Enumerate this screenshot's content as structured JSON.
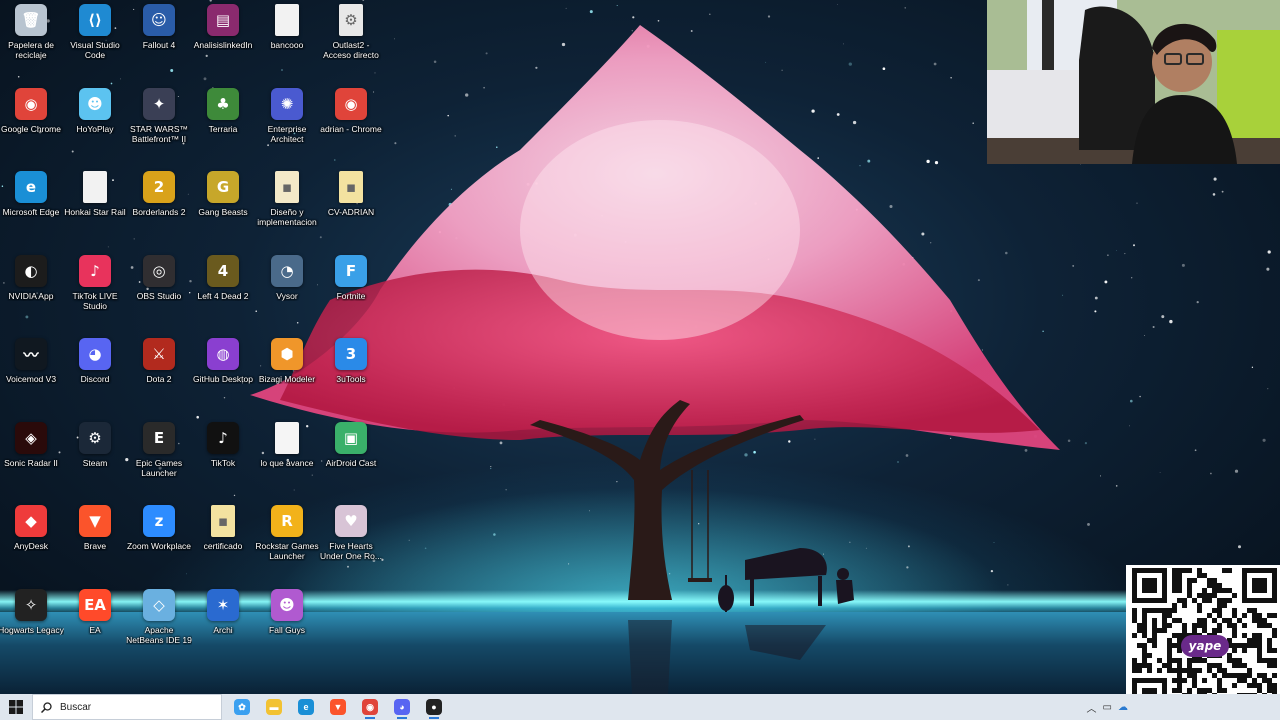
{
  "desktop": {
    "icons": [
      {
        "label": "Papelera de reciclaje",
        "icon": "recycle-bin-icon",
        "color": "#b8c4d0",
        "glyph": "🗑"
      },
      {
        "label": "Visual Studio Code",
        "icon": "vscode-icon",
        "color": "#1f8ad2",
        "glyph": "⟨⟩"
      },
      {
        "label": "Fallout 4",
        "icon": "fallout-icon",
        "color": "#2a5ca8",
        "glyph": "☺"
      },
      {
        "label": "AnalisislinkedIn",
        "icon": "winrar-icon",
        "color": "#8a2a6e",
        "glyph": "▤"
      },
      {
        "label": "bancooo",
        "icon": "file-icon",
        "color": "#f2f2f2",
        "glyph": ""
      },
      {
        "label": "Outlast2 - Acceso directo",
        "icon": "shortcut-icon",
        "color": "#e8e8e8",
        "glyph": "⚙"
      },
      {
        "label": "Google Chrome",
        "icon": "chrome-icon",
        "color": "#e0443a",
        "glyph": "◉"
      },
      {
        "label": "HoYoPlay",
        "icon": "hoyoplay-icon",
        "color": "#5cc3f0",
        "glyph": "☻"
      },
      {
        "label": "STAR WARS™ Battlefront™ II",
        "icon": "starwars-icon",
        "color": "#3a3f55",
        "glyph": "✦"
      },
      {
        "label": "Terraria",
        "icon": "terraria-icon",
        "color": "#3e8a3a",
        "glyph": "♣"
      },
      {
        "label": "Enterprise Architect",
        "icon": "ea-architect-icon",
        "color": "#4a5ad0",
        "glyph": "✺"
      },
      {
        "label": "adrian - Chrome",
        "icon": "chrome-profile-icon",
        "color": "#e0443a",
        "glyph": "◉"
      },
      {
        "label": "Microsoft Edge",
        "icon": "edge-icon",
        "color": "#1a8fd6",
        "glyph": "e"
      },
      {
        "label": "Honkai Star Rail",
        "icon": "file-icon",
        "color": "#f2f2f2",
        "glyph": ""
      },
      {
        "label": "Borderlands 2",
        "icon": "borderlands-icon",
        "color": "#d9a21a",
        "glyph": "2"
      },
      {
        "label": "Gang Beasts",
        "icon": "gangbeasts-icon",
        "color": "#c7a72a",
        "glyph": "G"
      },
      {
        "label": "Diseño y implementacion",
        "icon": "pdf-icon",
        "color": "#f3e9c8",
        "glyph": "▪"
      },
      {
        "label": "CV-ADRIAN",
        "icon": "pdf-icon",
        "color": "#f3e2a0",
        "glyph": "▪"
      },
      {
        "label": "NVIDIA App",
        "icon": "nvidia-icon",
        "color": "#1c1c1c",
        "glyph": "◐"
      },
      {
        "label": "TikTok LIVE Studio",
        "icon": "tiktok-live-icon",
        "color": "#e8335c",
        "glyph": "♪"
      },
      {
        "label": "OBS Studio",
        "icon": "obs-icon",
        "color": "#302e31",
        "glyph": "◎"
      },
      {
        "label": "Left 4 Dead 2",
        "icon": "l4d2-icon",
        "color": "#6a5a1e",
        "glyph": "4"
      },
      {
        "label": "Vysor",
        "icon": "vysor-icon",
        "color": "#4a6a8a",
        "glyph": "◔"
      },
      {
        "label": "Fortnite",
        "icon": "fortnite-icon",
        "color": "#3aa0e8",
        "glyph": "F"
      },
      {
        "label": "Voicemod V3",
        "icon": "voicemod-icon",
        "color": "#101820",
        "glyph": "〰"
      },
      {
        "label": "Discord",
        "icon": "discord-icon",
        "color": "#5865f2",
        "glyph": "◕"
      },
      {
        "label": "Dota 2",
        "icon": "dota-icon",
        "color": "#b22a1e",
        "glyph": "⚔"
      },
      {
        "label": "GitHub Desktop",
        "icon": "github-icon",
        "color": "#8a3fd0",
        "glyph": "◍"
      },
      {
        "label": "Bizagi Modeler",
        "icon": "bizagi-icon",
        "color": "#f0962a",
        "glyph": "⬢"
      },
      {
        "label": "3uTools",
        "icon": "3utools-icon",
        "color": "#2a8ae8",
        "glyph": "3"
      },
      {
        "label": "Sonic Radar II",
        "icon": "sonic-radar-icon",
        "color": "#2a0a0a",
        "glyph": "◈"
      },
      {
        "label": "Steam",
        "icon": "steam-icon",
        "color": "#1b2838",
        "glyph": "⚙"
      },
      {
        "label": "Epic Games Launcher",
        "icon": "epic-icon",
        "color": "#2a2a2a",
        "glyph": "E"
      },
      {
        "label": "TikTok",
        "icon": "tiktok-icon",
        "color": "#111111",
        "glyph": "♪"
      },
      {
        "label": "lo que avance",
        "icon": "text-file-icon",
        "color": "#f5f5f5",
        "glyph": ""
      },
      {
        "label": "AirDroid Cast",
        "icon": "airdroid-icon",
        "color": "#3ab06a",
        "glyph": "▣"
      },
      {
        "label": "AnyDesk",
        "icon": "anydesk-icon",
        "color": "#ef3b3b",
        "glyph": "◆"
      },
      {
        "label": "Brave",
        "icon": "brave-icon",
        "color": "#fb542b",
        "glyph": "▼"
      },
      {
        "label": "Zoom Workplace",
        "icon": "zoom-icon",
        "color": "#2d8cff",
        "glyph": "z"
      },
      {
        "label": "certificado",
        "icon": "pdf-icon",
        "color": "#f3e2a0",
        "glyph": "▪"
      },
      {
        "label": "Rockstar Games Launcher",
        "icon": "rockstar-icon",
        "color": "#f2b21a",
        "glyph": "R"
      },
      {
        "label": "Five Hearts Under One Ro...",
        "icon": "game-cover-icon",
        "color": "#d8c4d6",
        "glyph": "♥"
      },
      {
        "label": "Hogwarts Legacy",
        "icon": "hogwarts-icon",
        "color": "#222222",
        "glyph": "✧"
      },
      {
        "label": "EA",
        "icon": "ea-icon",
        "color": "#ff4a2a",
        "glyph": "EA"
      },
      {
        "label": "Apache NetBeans IDE 19",
        "icon": "netbeans-icon",
        "color": "#6ab0e0",
        "glyph": "◇"
      },
      {
        "label": "Archi",
        "icon": "archi-icon",
        "color": "#2a6ad0",
        "glyph": "✶"
      },
      {
        "label": "Fall Guys",
        "icon": "fallguys-icon",
        "color": "#b05ad0",
        "glyph": "☻"
      }
    ]
  },
  "taskbar": {
    "search_placeholder": "Buscar",
    "apps": [
      {
        "name": "copilot",
        "icon": "copilot-icon",
        "color": "#3aa0f0",
        "glyph": "✿",
        "active": false
      },
      {
        "name": "explorer",
        "icon": "file-explorer-icon",
        "color": "#f2c232",
        "glyph": "▬",
        "active": false
      },
      {
        "name": "edge",
        "icon": "edge-icon",
        "color": "#1a8fd6",
        "glyph": "e",
        "active": false
      },
      {
        "name": "brave",
        "icon": "brave-icon",
        "color": "#fb542b",
        "glyph": "▼",
        "active": false
      },
      {
        "name": "chrome",
        "icon": "chrome-icon",
        "color": "#e0443a",
        "glyph": "◉",
        "active": true
      },
      {
        "name": "discord",
        "icon": "discord-icon",
        "color": "#5865f2",
        "glyph": "◕",
        "active": true
      },
      {
        "name": "recorder",
        "icon": "recorder-icon",
        "color": "#222222",
        "glyph": "●",
        "active": true
      }
    ]
  },
  "qr": {
    "brand": "yape",
    "accent": "#6a2a8a"
  }
}
